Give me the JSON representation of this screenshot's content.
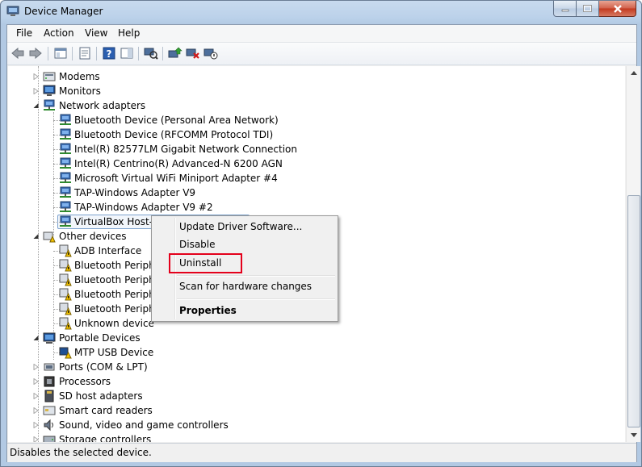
{
  "window": {
    "title": "Device Manager"
  },
  "menu": [
    "File",
    "Action",
    "View",
    "Help"
  ],
  "toolbar": {
    "icons": [
      "back-arrow-icon",
      "forward-arrow-icon",
      "show-hide-console-tree-icon",
      "properties-icon",
      "help-icon",
      "action-pane-icon",
      "scan-hardware-icon",
      "update-driver-icon",
      "uninstall-device-icon",
      "disable-device-icon"
    ]
  },
  "tree": {
    "categories_top": [
      {
        "label": "Modems",
        "icon": "modem-icon"
      },
      {
        "label": "Monitors",
        "icon": "monitor-icon"
      },
      {
        "label": "Network adapters",
        "icon": "network-adapter-icon"
      }
    ],
    "network_adapters": [
      "Bluetooth Device (Personal Area Network)",
      "Bluetooth Device (RFCOMM Protocol TDI)",
      "Intel(R) 82577LM Gigabit Network Connection",
      "Intel(R) Centrino(R) Advanced-N 6200 AGN",
      "Microsoft Virtual WiFi Miniport Adapter #4",
      "TAP-Windows Adapter V9",
      "TAP-Windows Adapter V9 #2",
      "VirtualBox Host-O"
    ],
    "other_devices": {
      "label": "Other devices",
      "items": [
        "ADB Interface",
        "Bluetooth Periphe",
        "Bluetooth Periphe",
        "Bluetooth Periphe",
        "Bluetooth Periphe",
        "Unknown device"
      ]
    },
    "portable_devices": {
      "label": "Portable Devices",
      "items": [
        "MTP USB Device"
      ]
    },
    "categories_bottom": [
      {
        "label": "Ports (COM & LPT)",
        "icon": "port-icon"
      },
      {
        "label": "Processors",
        "icon": "processor-icon"
      },
      {
        "label": "SD host adapters",
        "icon": "sd-host-icon"
      },
      {
        "label": "Smart card readers",
        "icon": "smart-card-icon"
      },
      {
        "label": "Sound, video and game controllers",
        "icon": "sound-icon"
      },
      {
        "label": "Storage controllers",
        "icon": "storage-icon"
      }
    ]
  },
  "context_menu": {
    "update_driver": "Update Driver Software...",
    "disable": "Disable",
    "uninstall": "Uninstall",
    "scan": "Scan for hardware changes",
    "properties": "Properties"
  },
  "status": "Disables the selected device.",
  "colors": {
    "highlight": "#e4001b",
    "title_bg": "#bcd2ea"
  }
}
